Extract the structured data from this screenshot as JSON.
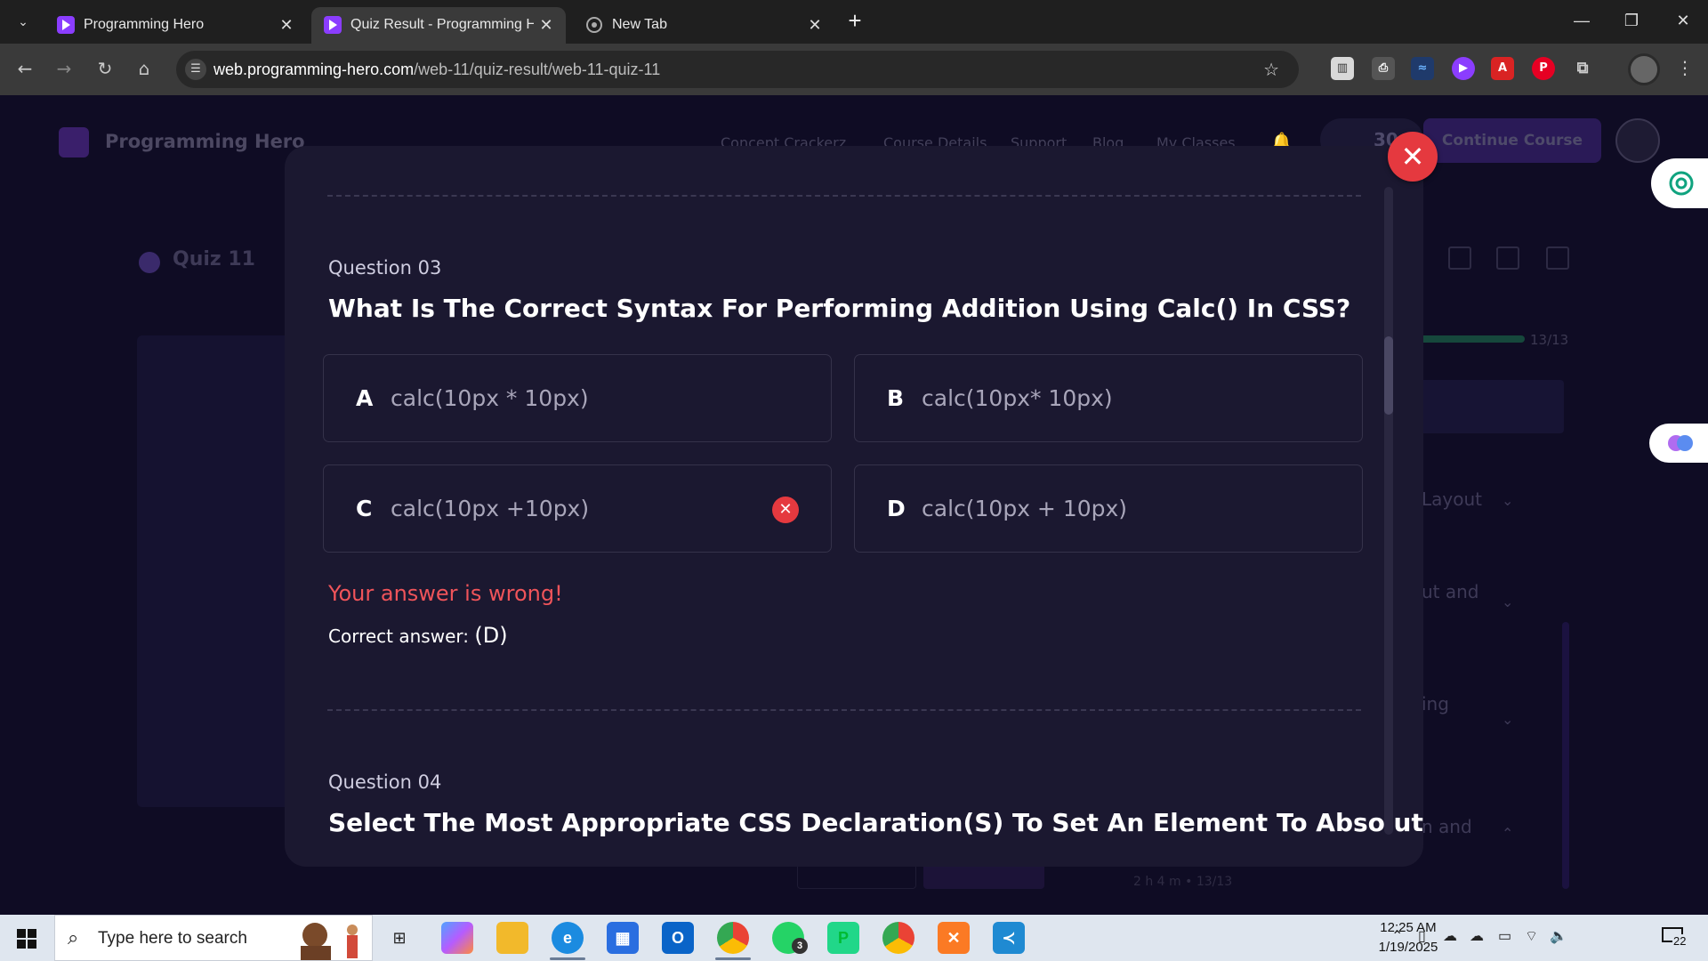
{
  "browser": {
    "tabs": [
      {
        "title": "Programming Hero",
        "active": false
      },
      {
        "title": "Quiz Result - Programming Her",
        "active": true
      },
      {
        "title": "New Tab",
        "active": false
      }
    ],
    "url_domain": "web.programming-hero.com",
    "url_path": "/web-11/quiz-result/web-11-quiz-11"
  },
  "background_page": {
    "brand": "Programming Hero",
    "nav": [
      "Concept Crackerz",
      "Course Details",
      "Support",
      "Blog",
      "My Classes"
    ],
    "gems": "30",
    "cta": "Continue Course",
    "quiz_title": "Quiz 11",
    "progress_count": "13/13",
    "accordion": [
      {
        "label": "Layout",
        "chevron": "chevron-down-icon"
      },
      {
        "label": "ut and",
        "chevron": "chevron-down-icon"
      },
      {
        "label": "ing",
        "chevron": "chevron-down-icon"
      },
      {
        "label": "n and",
        "chevron": "chevron-up-icon"
      }
    ],
    "footer_meta": "2 h 4 m • 13/13"
  },
  "modal": {
    "question3": {
      "number": "Question 03",
      "text": "What Is The Correct Syntax For Performing Addition Using Calc() In CSS?",
      "options": [
        {
          "letter": "A",
          "text": "calc(10px * 10px)"
        },
        {
          "letter": "B",
          "text": "calc(10px* 10px)"
        },
        {
          "letter": "C",
          "text": "calc(10px +10px)",
          "selected_wrong": true
        },
        {
          "letter": "D",
          "text": "calc(10px + 10px)"
        }
      ],
      "feedback": "Your answer is wrong!",
      "correct_label": "Correct answer:",
      "correct_value": "(D)"
    },
    "question4": {
      "number": "Question 04",
      "text": "Select The Most Appropriate CSS Declaration(S) To Set An Element To Absolute"
    }
  },
  "taskbar": {
    "search_placeholder": "Type here to search",
    "time": "12:25 AM",
    "date": "1/19/2025",
    "notification_count": "22",
    "whatsapp_badge": "3"
  },
  "colors": {
    "accent_wrong": "#e5393f",
    "brand_purple": "#8b3dff",
    "modal_bg": "#1b1830"
  }
}
